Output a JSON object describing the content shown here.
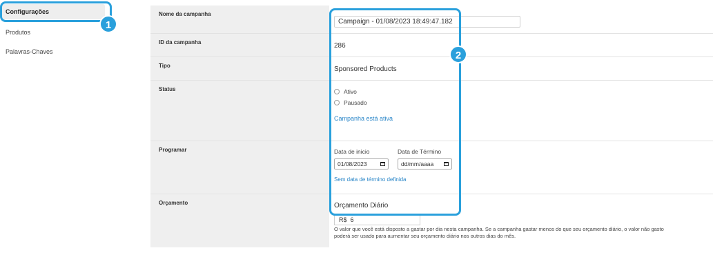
{
  "sidebar": {
    "items": [
      {
        "label": "Configurações"
      },
      {
        "label": "Produtos"
      },
      {
        "label": "Palavras-Chaves"
      }
    ]
  },
  "callouts": {
    "one": "1",
    "two": "2"
  },
  "rows": {
    "name": {
      "label": "Nome da campanha",
      "value": "Campaign - 01/08/2023 18:49:47.182"
    },
    "id": {
      "label": "ID da campanha",
      "value": "286"
    },
    "type": {
      "label": "Tipo",
      "value": "Sponsored Products"
    },
    "status": {
      "label": "Status",
      "options": [
        "Ativo",
        "Pausado"
      ],
      "link": "Campanha está ativa"
    },
    "schedule": {
      "label": "Programar",
      "start_label": "Data de inicio",
      "start_value": "01/08/2023",
      "end_label": "Data de Término",
      "end_value": "dd/mm/aaaa",
      "link": "Sem data de término definida"
    },
    "budget": {
      "label": "Orçamento",
      "title": "Orçamento Diário",
      "value": "R$  6",
      "help_line1": "O valor que você está disposto a gastar por dia nesta campanha. Se a campanha gastar menos do que seu orçamento diário, o valor não gasto",
      "help_line2": "poderá ser usado para aumentar seu orçamento diário nos outros dias do mês."
    }
  },
  "colors": {
    "accent": "#2aa0dc",
    "link": "#2a86c8"
  }
}
